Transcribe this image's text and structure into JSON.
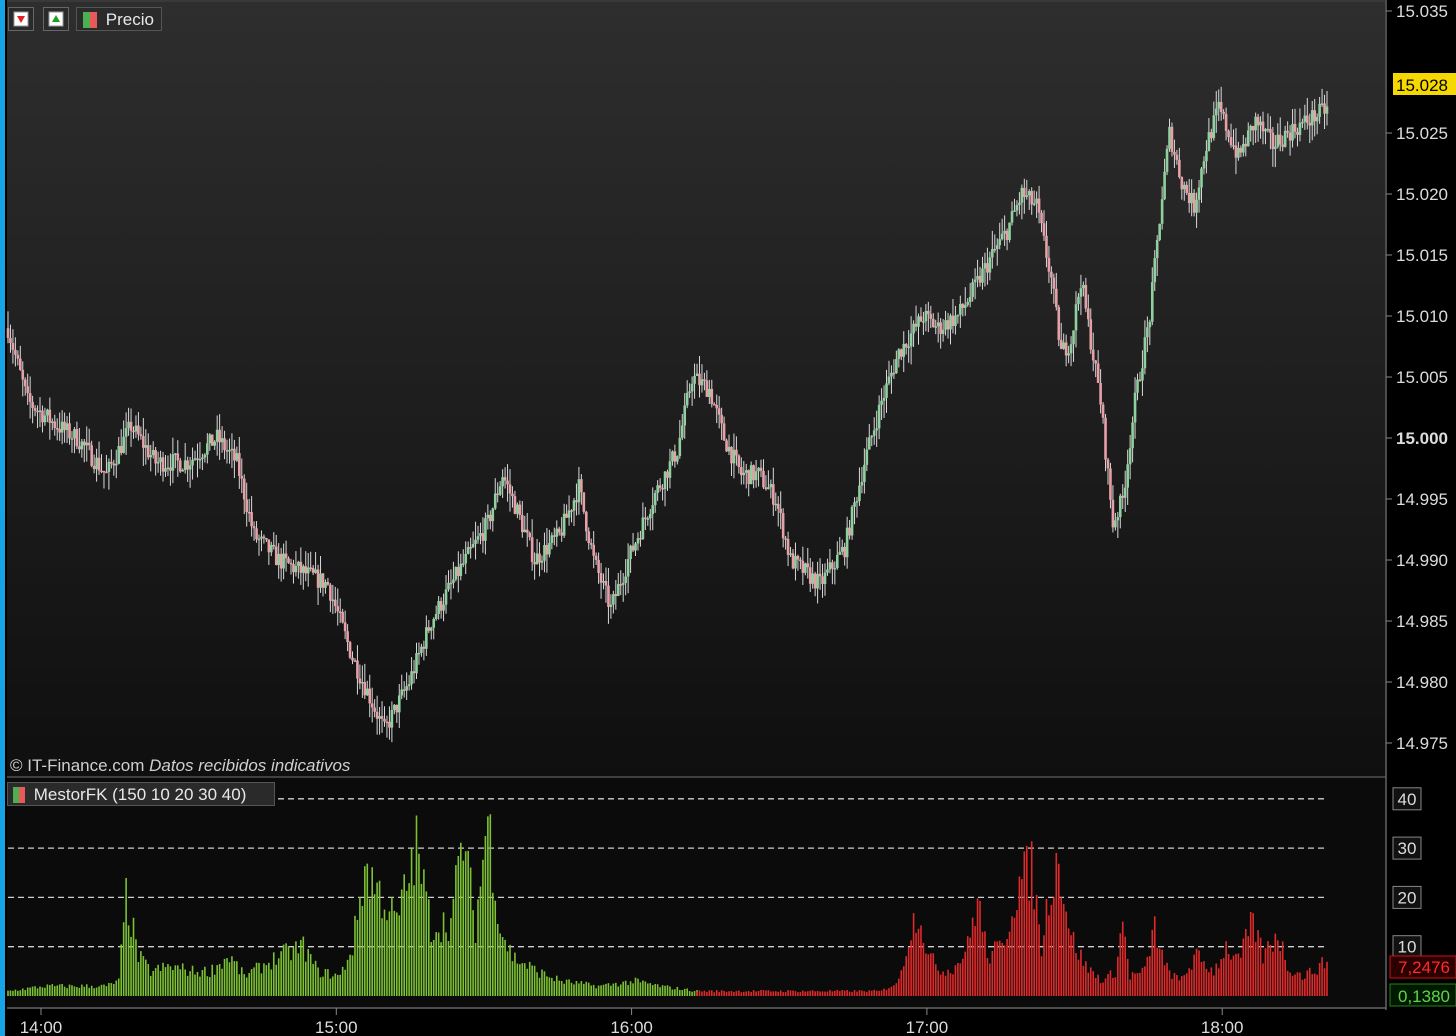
{
  "price_panel": {
    "indicator_label": "Precio",
    "credit_source": "© IT-Finance.com",
    "credit_note": "Datos recibidos indicativos",
    "current_price_label": "15.028",
    "buttons": [
      "sell-arrow-icon",
      "buy-arrow-icon"
    ]
  },
  "indicator_panel": {
    "label": "MestorFK (150 10 20 30 40)",
    "red_value_label": "7,2476",
    "green_value_label": "0,1380"
  },
  "colors": {
    "bull": "#8fd19e",
    "bear": "#e8a0a8",
    "wick": "#d9d9d9",
    "green_bar": "#7cc234",
    "red_bar": "#e02a2a",
    "price_tag": "#f5d800",
    "red_tag": "#d01010",
    "green_tag": "#2e7d1f"
  },
  "chart_data": [
    {
      "type": "candlestick",
      "title": "Precio",
      "x_ticks": [
        "14:00",
        "15:00",
        "16:00",
        "17:00",
        "18:00"
      ],
      "y_ticks": [
        "14.975",
        "14.980",
        "14.985",
        "14.990",
        "14.995",
        "15.000",
        "15.005",
        "15.010",
        "15.015",
        "15.020",
        "15.025",
        "15.035"
      ],
      "ylim": [
        14.972,
        15.036
      ],
      "approx_close_path": [
        [
          0,
          15.009
        ],
        [
          8,
          15.003
        ],
        [
          20,
          15.001
        ],
        [
          28,
          15.0
        ],
        [
          40,
          14.997
        ],
        [
          50,
          15.001
        ],
        [
          60,
          14.998
        ],
        [
          73,
          14.998
        ],
        [
          85,
          15.0
        ],
        [
          93,
          14.998
        ],
        [
          100,
          14.992
        ],
        [
          110,
          14.99
        ],
        [
          120,
          14.989
        ],
        [
          130,
          14.988
        ],
        [
          140,
          14.982
        ],
        [
          153,
          14.976
        ],
        [
          163,
          14.98
        ],
        [
          172,
          14.985
        ],
        [
          183,
          14.989
        ],
        [
          195,
          14.993
        ],
        [
          201,
          14.997
        ],
        [
          207,
          14.994
        ],
        [
          214,
          14.99
        ],
        [
          224,
          14.992
        ],
        [
          232,
          14.996
        ],
        [
          238,
          14.99
        ],
        [
          245,
          14.986
        ],
        [
          252,
          14.99
        ],
        [
          262,
          14.995
        ],
        [
          272,
          14.999
        ],
        [
          278,
          15.005
        ],
        [
          285,
          15.004
        ],
        [
          291,
          15.0
        ],
        [
          298,
          14.997
        ],
        [
          305,
          14.997
        ],
        [
          312,
          14.995
        ],
        [
          318,
          14.99
        ],
        [
          330,
          14.988
        ],
        [
          340,
          14.991
        ],
        [
          348,
          14.998
        ],
        [
          355,
          15.003
        ],
        [
          362,
          15.007
        ],
        [
          372,
          15.01
        ],
        [
          378,
          15.009
        ],
        [
          386,
          15.01
        ],
        [
          392,
          15.012
        ],
        [
          400,
          15.015
        ],
        [
          406,
          15.017
        ],
        [
          412,
          15.02
        ],
        [
          418,
          15.019
        ],
        [
          424,
          15.013
        ],
        [
          428,
          15.007
        ],
        [
          432,
          15.008
        ],
        [
          436,
          15.013
        ],
        [
          440,
          15.008
        ],
        [
          444,
          15.003
        ],
        [
          449,
          14.993
        ],
        [
          453,
          14.995
        ],
        [
          458,
          15.003
        ],
        [
          464,
          15.01
        ],
        [
          468,
          15.018
        ],
        [
          472,
          15.025
        ],
        [
          477,
          15.021
        ],
        [
          482,
          15.019
        ],
        [
          487,
          15.024
        ],
        [
          492,
          15.027
        ],
        [
          500,
          15.023
        ],
        [
          507,
          15.026
        ],
        [
          514,
          15.024
        ],
        [
          520,
          15.025
        ],
        [
          528,
          15.026
        ],
        [
          536,
          15.027
        ]
      ]
    },
    {
      "type": "bar",
      "title": "MestorFK (150 10 20 30 40)",
      "y_ticks": [
        10,
        20,
        30,
        40
      ],
      "ylim": [
        0,
        41
      ],
      "reference_lines": [
        10,
        20,
        30,
        40
      ],
      "series": [
        {
          "name": "green",
          "color": "#7cc234",
          "x_range": [
            0,
            280
          ],
          "approx_path": [
            [
              0,
              1
            ],
            [
              15,
              2
            ],
            [
              40,
              2
            ],
            [
              45,
              3
            ],
            [
              48,
              20
            ],
            [
              53,
              8
            ],
            [
              58,
              5
            ],
            [
              66,
              6
            ],
            [
              75,
              5
            ],
            [
              82,
              5
            ],
            [
              90,
              8
            ],
            [
              96,
              4
            ],
            [
              110,
              8
            ],
            [
              120,
              10
            ],
            [
              126,
              5
            ],
            [
              135,
              4
            ],
            [
              140,
              10
            ],
            [
              145,
              26
            ],
            [
              152,
              20
            ],
            [
              158,
              15
            ],
            [
              166,
              30
            ],
            [
              172,
              14
            ],
            [
              180,
              15
            ],
            [
              185,
              32
            ],
            [
              190,
              14
            ],
            [
              195,
              37
            ],
            [
              200,
              14
            ],
            [
              205,
              8
            ],
            [
              215,
              5
            ],
            [
              225,
              3
            ],
            [
              240,
              2
            ],
            [
              255,
              3
            ],
            [
              265,
              2
            ],
            [
              280,
              1
            ]
          ]
        },
        {
          "name": "red",
          "color": "#e02a2a",
          "x_range": [
            280,
            536
          ],
          "approx_path": [
            [
              280,
              1
            ],
            [
              310,
              1
            ],
            [
              355,
              1
            ],
            [
              362,
              3
            ],
            [
              366,
              12
            ],
            [
              370,
              18
            ],
            [
              374,
              8
            ],
            [
              380,
              5
            ],
            [
              385,
              6
            ],
            [
              390,
              10
            ],
            [
              394,
              20
            ],
            [
              398,
              8
            ],
            [
              404,
              10
            ],
            [
              410,
              22
            ],
            [
              416,
              26
            ],
            [
              420,
              10
            ],
            [
              424,
              24
            ],
            [
              427,
              28
            ],
            [
              432,
              12
            ],
            [
              438,
              6
            ],
            [
              445,
              3
            ],
            [
              450,
              5
            ],
            [
              453,
              15
            ],
            [
              456,
              4
            ],
            [
              462,
              5
            ],
            [
              466,
              14
            ],
            [
              470,
              6
            ],
            [
              476,
              3
            ],
            [
              483,
              8
            ],
            [
              490,
              5
            ],
            [
              495,
              10
            ],
            [
              500,
              7
            ],
            [
              506,
              15
            ],
            [
              510,
              8
            ],
            [
              516,
              13
            ],
            [
              520,
              6
            ],
            [
              526,
              4
            ],
            [
              530,
              5
            ],
            [
              536,
              7
            ]
          ]
        }
      ]
    }
  ]
}
